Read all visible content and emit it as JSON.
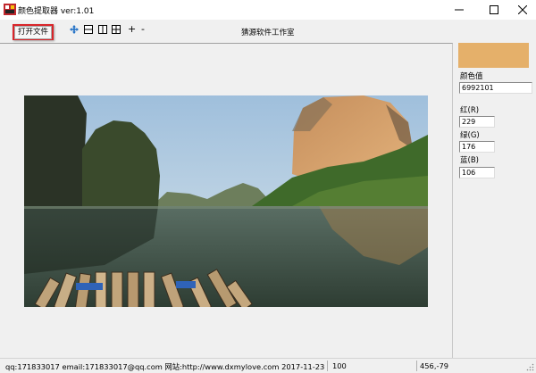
{
  "window": {
    "title": "颜色提取器 ver:1.01",
    "controls": [
      "minimize",
      "maximize",
      "close"
    ]
  },
  "toolbar": {
    "open_file_label": "打开文件",
    "tool_icons": [
      "move-icon",
      "fit-horizontal-icon",
      "fit-vertical-icon",
      "fit-window-icon"
    ],
    "zoom_in_label": "+",
    "zoom_out_label": "-",
    "studio_label": "猜源软件工作室"
  },
  "color_panel": {
    "swatch_color": "#e5b06a",
    "color_value_label": "颜色值",
    "color_value": "6992101",
    "red_label": "红(R)",
    "red_value": "229",
    "green_label": "绿(G)",
    "green_value": "176",
    "blue_label": "蓝(B)",
    "blue_value": "106"
  },
  "image": {
    "description_icon": "landscape-photo"
  },
  "status_bar": {
    "contact": "qq:171833017 email:171833017@qq.com 网站:http://www.dxmylove.com 2017-11-23",
    "zoom": "100",
    "coordinates": "456,-79"
  }
}
